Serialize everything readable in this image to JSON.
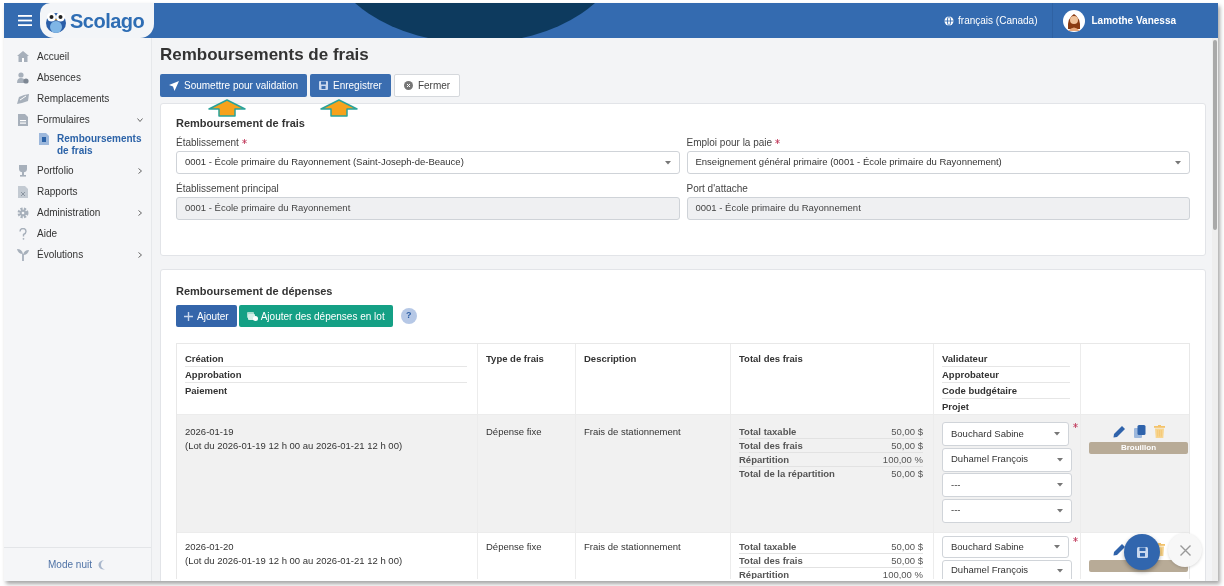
{
  "header": {
    "app_name": "Scolago",
    "language": "français (Canada)",
    "user": "Lamothe Vanessa"
  },
  "sidebar": {
    "items": [
      {
        "label": "Accueil",
        "selected": false
      },
      {
        "label": "Absences",
        "selected": false
      },
      {
        "label": "Remplacements",
        "selected": false
      },
      {
        "label": "Formulaires",
        "selected": false,
        "expanded": true,
        "children": [
          {
            "label": "Remboursements de frais",
            "selected": true
          }
        ]
      },
      {
        "label": "Portfolio",
        "selected": false,
        "expanded": false
      },
      {
        "label": "Rapports",
        "selected": false
      },
      {
        "label": "Administration",
        "selected": false,
        "expanded": false
      },
      {
        "label": "Aide",
        "selected": false
      },
      {
        "label": "Évolutions",
        "selected": false,
        "expanded": false
      }
    ],
    "night_mode": "Mode nuit"
  },
  "page": {
    "title": "Remboursements de frais",
    "actions": [
      {
        "label": "Soumettre pour validation",
        "kind": "submit"
      },
      {
        "label": "Enregistrer",
        "kind": "save"
      },
      {
        "label": "Fermer",
        "kind": "close"
      }
    ]
  },
  "general_section": {
    "title": "Remboursement de frais",
    "fields": [
      {
        "label": "Établissement",
        "required": true,
        "value": "0001 - École primaire du Rayonnement (Saint-Joseph-de-Beauce)",
        "kind": "select"
      },
      {
        "label": "Emploi pour la paie",
        "required": true,
        "value": "Enseignement général primaire (0001 - École primaire du Rayonnement)",
        "kind": "select"
      },
      {
        "label": "Établissement principal",
        "required": false,
        "value": "0001 - École primaire du Rayonnement",
        "kind": "readonly"
      },
      {
        "label": "Port d'attache",
        "required": false,
        "value": "0001 - École primaire du Rayonnement",
        "kind": "readonly"
      }
    ]
  },
  "expenses_section": {
    "title": "Remboursement de dépenses",
    "buttons": [
      {
        "label": "Ajouter",
        "kind": "add"
      },
      {
        "label": "Ajouter des dépenses en lot",
        "kind": "batch"
      }
    ],
    "help": "?",
    "table": {
      "columns": [
        {
          "lines": [
            "Création",
            "Approbation",
            "Paiement"
          ]
        },
        {
          "lines": [
            "Type de frais"
          ]
        },
        {
          "lines": [
            "Description"
          ]
        },
        {
          "lines": [
            "Total des frais"
          ]
        },
        {
          "lines": [
            "Validateur",
            "Approbateur",
            "Code budgétaire",
            "Projet"
          ]
        }
      ],
      "rows": [
        {
          "created": "2026-01-19",
          "batch": "(Lot du 2026-01-19 12 h 00 au 2026-01-21 12 h 00)",
          "expense_type": "Dépense fixe",
          "description": "Frais de stationnement",
          "selected": true,
          "totals": [
            {
              "label": "Total taxable",
              "value": "50,00 $"
            },
            {
              "label": "Total des frais",
              "value": "50,00 $"
            },
            {
              "label": "Répartition",
              "value": "100,00 %"
            },
            {
              "label": "Total de la répartition",
              "value": "50,00 $"
            }
          ],
          "assignees": [
            {
              "value": "Bouchard Sabine",
              "required": true
            },
            {
              "value": "Duhamel François",
              "required": false
            },
            {
              "value": "---",
              "required": false
            },
            {
              "value": "---",
              "required": false
            }
          ],
          "status": "Brouillon"
        },
        {
          "created": "2026-01-20",
          "batch": "(Lot du 2026-01-19 12 h 00 au 2026-01-21 12 h 00)",
          "expense_type": "Dépense fixe",
          "description": "Frais de stationnement",
          "selected": false,
          "totals": [
            {
              "label": "Total taxable",
              "value": "50,00 $"
            },
            {
              "label": "Total des frais",
              "value": "50,00 $"
            },
            {
              "label": "Répartition",
              "value": "100,00 %"
            }
          ],
          "assignees": [
            {
              "value": "Bouchard Sabine",
              "required": true
            },
            {
              "value": "Duhamel François",
              "required": false
            }
          ]
        }
      ]
    }
  }
}
